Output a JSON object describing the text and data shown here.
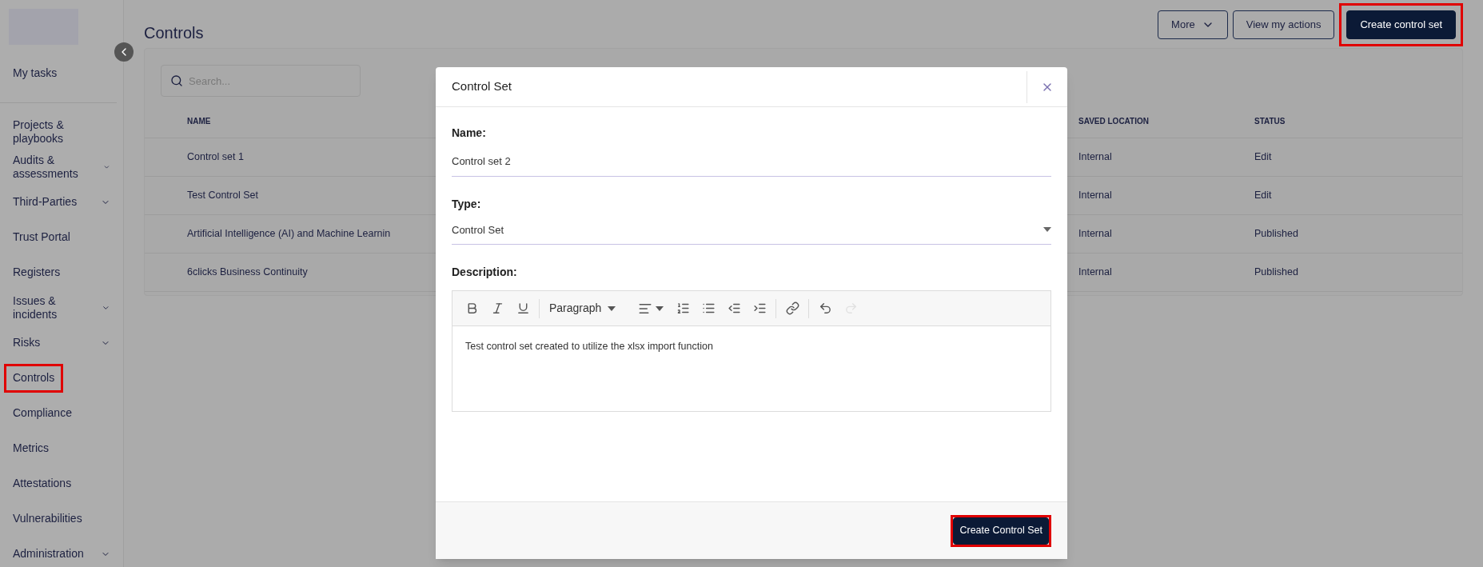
{
  "sidebar": {
    "top_item": {
      "label": "My tasks",
      "expandable": false,
      "highlighted": false
    },
    "items": [
      {
        "label": "Projects & playbooks",
        "expandable": false,
        "highlighted": false
      },
      {
        "label": "Audits & assessments",
        "expandable": true,
        "highlighted": false
      },
      {
        "label": "Third-Parties",
        "expandable": true,
        "highlighted": false
      },
      {
        "label": "Trust Portal",
        "expandable": false,
        "highlighted": false
      },
      {
        "label": "Registers",
        "expandable": false,
        "highlighted": false
      },
      {
        "label": "Issues & incidents",
        "expandable": true,
        "highlighted": false
      },
      {
        "label": "Risks",
        "expandable": true,
        "highlighted": false
      },
      {
        "label": "Controls",
        "expandable": false,
        "highlighted": true
      },
      {
        "label": "Compliance",
        "expandable": false,
        "highlighted": false
      },
      {
        "label": "Metrics",
        "expandable": false,
        "highlighted": false
      },
      {
        "label": "Attestations",
        "expandable": false,
        "highlighted": false
      },
      {
        "label": "Vulnerabilities",
        "expandable": false,
        "highlighted": false
      },
      {
        "label": "Administration",
        "expandable": true,
        "highlighted": false
      }
    ]
  },
  "page": {
    "title": "Controls",
    "buttons": [
      {
        "label": "More",
        "kind": "dropdown",
        "highlighted": false
      },
      {
        "label": "View my actions",
        "kind": "outline",
        "highlighted": false
      },
      {
        "label": "Create control set",
        "kind": "primary",
        "highlighted": true
      }
    ]
  },
  "search": {
    "placeholder": "Search..."
  },
  "table": {
    "columns": [
      "NAME",
      "SAVED LOCATION",
      "STATUS"
    ],
    "rows": [
      {
        "name": "Control set 1",
        "saved_location": "Internal",
        "status": "Edit"
      },
      {
        "name": "Test Control Set",
        "saved_location": "Internal",
        "status": "Edit"
      },
      {
        "name": "Artificial Intelligence (AI) and Machine Learnin",
        "saved_location": "Internal",
        "status": "Published"
      },
      {
        "name": "6clicks Business Continuity",
        "saved_location": "Internal",
        "status": "Published"
      }
    ]
  },
  "modal": {
    "title": "Control Set",
    "fields": [
      {
        "kind": "text",
        "label": "Name:",
        "value": "Control set 2"
      },
      {
        "kind": "select",
        "label": "Type:",
        "value": "Control Set"
      },
      {
        "kind": "editor",
        "label": "Description:",
        "block_format": "Paragraph",
        "value": "Test control set created to utilize the xlsx import function"
      }
    ],
    "toolbar": [
      {
        "kind": "bold",
        "disabled": false
      },
      {
        "kind": "italic",
        "disabled": false
      },
      {
        "kind": "underline",
        "disabled": false
      },
      {
        "kind": "separator"
      },
      {
        "kind": "format"
      },
      {
        "kind": "align"
      },
      {
        "kind": "ordered-list",
        "disabled": false
      },
      {
        "kind": "bullet-list",
        "disabled": false
      },
      {
        "kind": "outdent",
        "disabled": false
      },
      {
        "kind": "indent",
        "disabled": false
      },
      {
        "kind": "separator"
      },
      {
        "kind": "link",
        "disabled": false
      },
      {
        "kind": "separator"
      },
      {
        "kind": "undo",
        "disabled": false
      },
      {
        "kind": "redo",
        "disabled": true
      }
    ],
    "submit": {
      "label": "Create Control Set",
      "highlighted": true
    }
  }
}
